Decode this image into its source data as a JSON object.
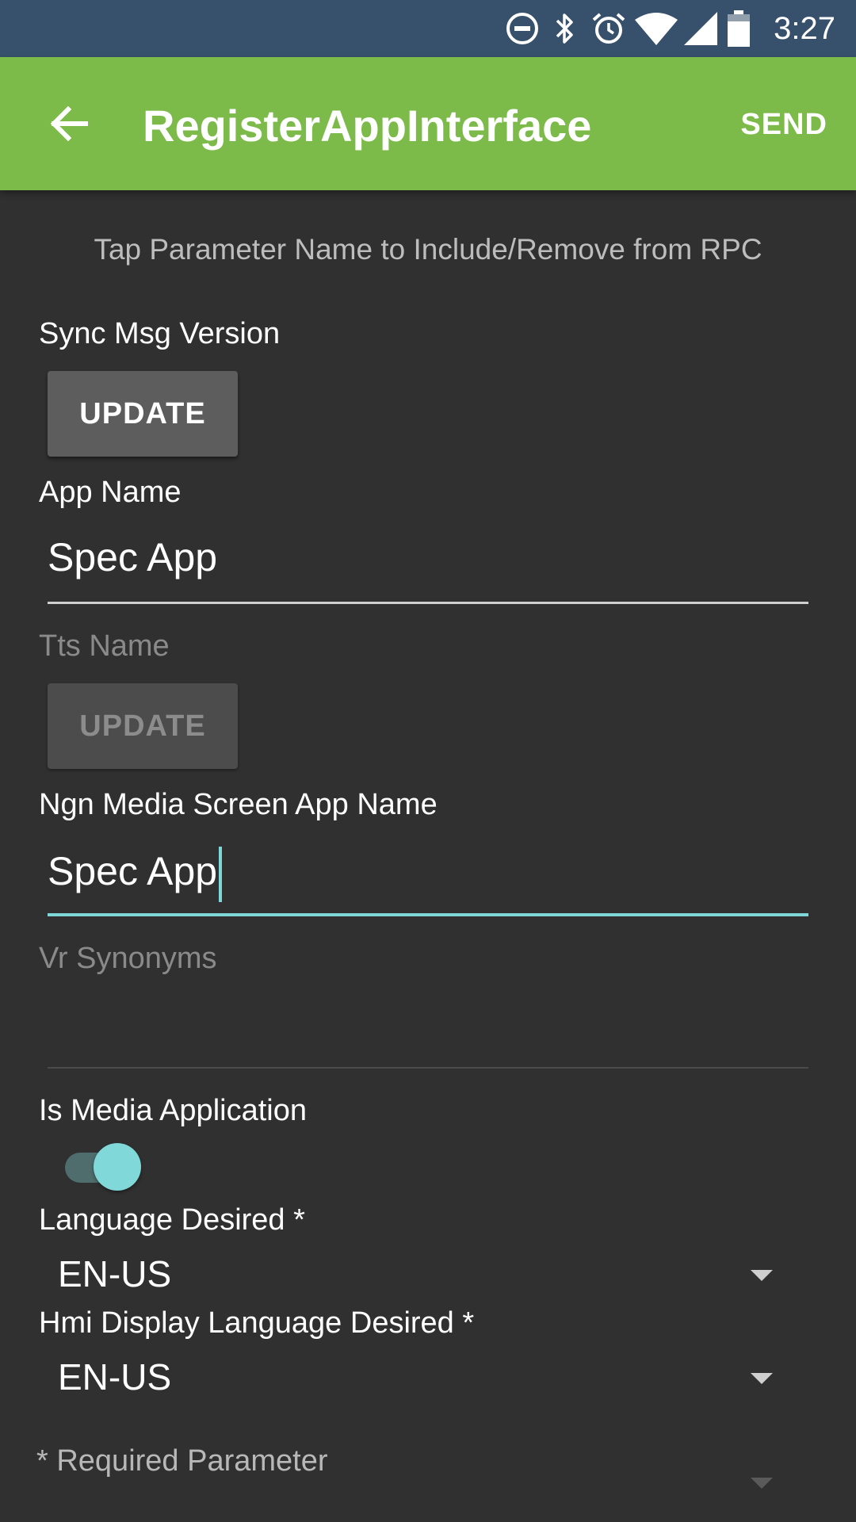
{
  "status_bar": {
    "time": "3:27",
    "icons": [
      "do-not-disturb-icon",
      "bluetooth-icon",
      "alarm-icon",
      "wifi-icon",
      "cellular-signal-icon",
      "battery-icon"
    ]
  },
  "app_bar": {
    "title": "RegisterAppInterface",
    "send_label": "SEND",
    "back_icon": "arrow-left-icon"
  },
  "hint": "Tap Parameter Name to Include/Remove from RPC",
  "fields": {
    "sync_msg_version": {
      "label": "Sync Msg Version",
      "button": "UPDATE"
    },
    "app_name": {
      "label": "App Name",
      "value": "Spec App"
    },
    "tts_name": {
      "label": "Tts Name",
      "button": "UPDATE"
    },
    "ngn_media_screen_app_name": {
      "label": "Ngn Media Screen App Name",
      "value": "Spec App"
    },
    "vr_synonyms": {
      "label": "Vr Synonyms",
      "value": ""
    },
    "is_media_application": {
      "label": "Is Media Application",
      "checked": true
    },
    "language_desired": {
      "label": "Language Desired *",
      "value": "EN-US"
    },
    "hmi_display_language_desired": {
      "label": "Hmi Display Language Desired *",
      "value": "EN-US"
    }
  },
  "footnote": "* Required Parameter",
  "colors": {
    "status_bar": "#37506b",
    "app_bar": "#7cba4a",
    "background": "#303030",
    "accent": "#80d8d8"
  }
}
